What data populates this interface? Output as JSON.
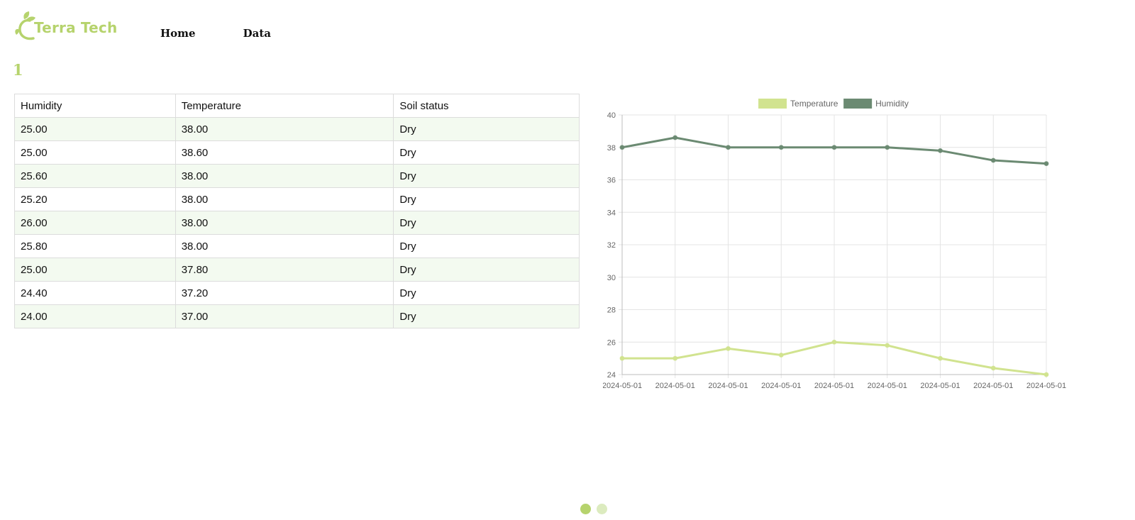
{
  "brand": {
    "name": "Terra Tech",
    "color": "#b6d36d",
    "logo_icon": "leaf-sprout-icon"
  },
  "nav": [
    {
      "label": "Home"
    },
    {
      "label": "Data"
    }
  ],
  "device_id": "1",
  "table": {
    "headers": [
      "Humidity",
      "Temperature",
      "Soil status"
    ],
    "rows": [
      [
        "25.00",
        "38.00",
        "Dry"
      ],
      [
        "25.00",
        "38.60",
        "Dry"
      ],
      [
        "25.60",
        "38.00",
        "Dry"
      ],
      [
        "25.20",
        "38.00",
        "Dry"
      ],
      [
        "26.00",
        "38.00",
        "Dry"
      ],
      [
        "25.80",
        "38.00",
        "Dry"
      ],
      [
        "25.00",
        "37.80",
        "Dry"
      ],
      [
        "24.40",
        "37.20",
        "Dry"
      ],
      [
        "24.00",
        "37.00",
        "Dry"
      ]
    ]
  },
  "chart_data": {
    "type": "line",
    "x": [
      "2024-05-01",
      "2024-05-01",
      "2024-05-01",
      "2024-05-01",
      "2024-05-01",
      "2024-05-01",
      "2024-05-01",
      "2024-05-01",
      "2024-05-01"
    ],
    "series": [
      {
        "name": "Temperature",
        "color": "#d1e38f",
        "values": [
          25.0,
          25.0,
          25.6,
          25.2,
          26.0,
          25.8,
          25.0,
          24.4,
          24.0
        ]
      },
      {
        "name": "Humidity",
        "color": "#6b8a72",
        "values": [
          38.0,
          38.6,
          38.0,
          38.0,
          38.0,
          38.0,
          37.8,
          37.2,
          37.0
        ]
      }
    ],
    "ylim": [
      24,
      40
    ],
    "yticks": [
      24,
      26,
      28,
      30,
      32,
      34,
      36,
      38,
      40
    ],
    "grid": true,
    "legend": "top-center"
  },
  "pagination": {
    "active_color": "#b6d36d",
    "inactive_color": "#dcebbf",
    "count": 2,
    "active_index": 0
  }
}
